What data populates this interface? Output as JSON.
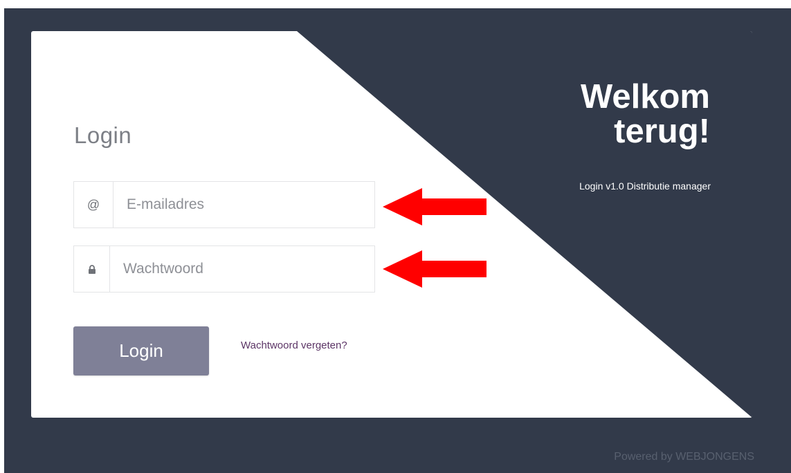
{
  "login_form": {
    "heading": "Login",
    "email": {
      "icon_text": "@",
      "icon": "at-sign-icon",
      "placeholder": "E-mailadres",
      "value": ""
    },
    "password": {
      "icon": "lock-icon",
      "placeholder": "Wachtwoord",
      "value": ""
    },
    "submit_label": "Login",
    "forgot_label": "Wachtwoord vergeten?"
  },
  "welcome_panel": {
    "title": "Welkom terug!",
    "subtitle": "Login v1.0 Distributie manager"
  },
  "footer": {
    "powered_by": "Powered by WEBJONGENS"
  },
  "annotations": {
    "arrow_icon": "left-arrow-icon",
    "arrow_color": "#ff0000"
  },
  "colors": {
    "background": "#323a4a",
    "card": "#ffffff",
    "button": "#7f8097",
    "link": "#5c3566"
  }
}
